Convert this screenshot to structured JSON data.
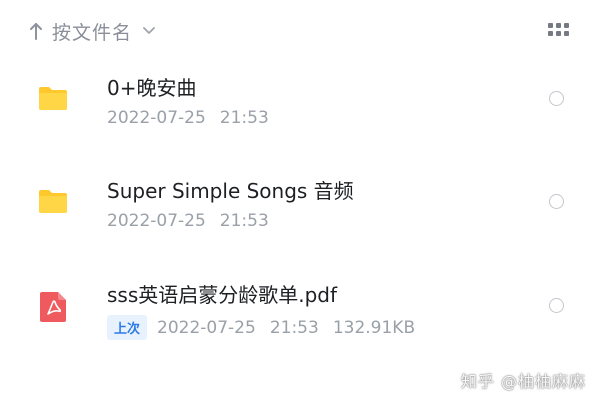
{
  "sort": {
    "label": "按文件名"
  },
  "items": [
    {
      "type": "folder",
      "name": "0+晚安曲",
      "date": "2022-07-25",
      "time": "21:53"
    },
    {
      "type": "folder",
      "name": "Super Simple Songs 音频",
      "date": "2022-07-25",
      "time": "21:53"
    },
    {
      "type": "pdf",
      "badge": "上次",
      "name": "sss英语启蒙分龄歌单.pdf",
      "date": "2022-07-25",
      "time": "21:53",
      "size": "132.91KB"
    }
  ],
  "watermark": "知乎 @柚柚麻麻",
  "colors": {
    "folder": "#ffcc33",
    "pdf": "#ef5a5f",
    "badge_bg": "#e8f2ff",
    "badge_text": "#2c7be5",
    "meta_text": "#9aa0a8"
  },
  "icons": [
    "sort-up-arrow-icon",
    "chevron-down-icon",
    "grid-view-icon",
    "folder-icon",
    "pdf-icon",
    "radio-circle-icon"
  ]
}
